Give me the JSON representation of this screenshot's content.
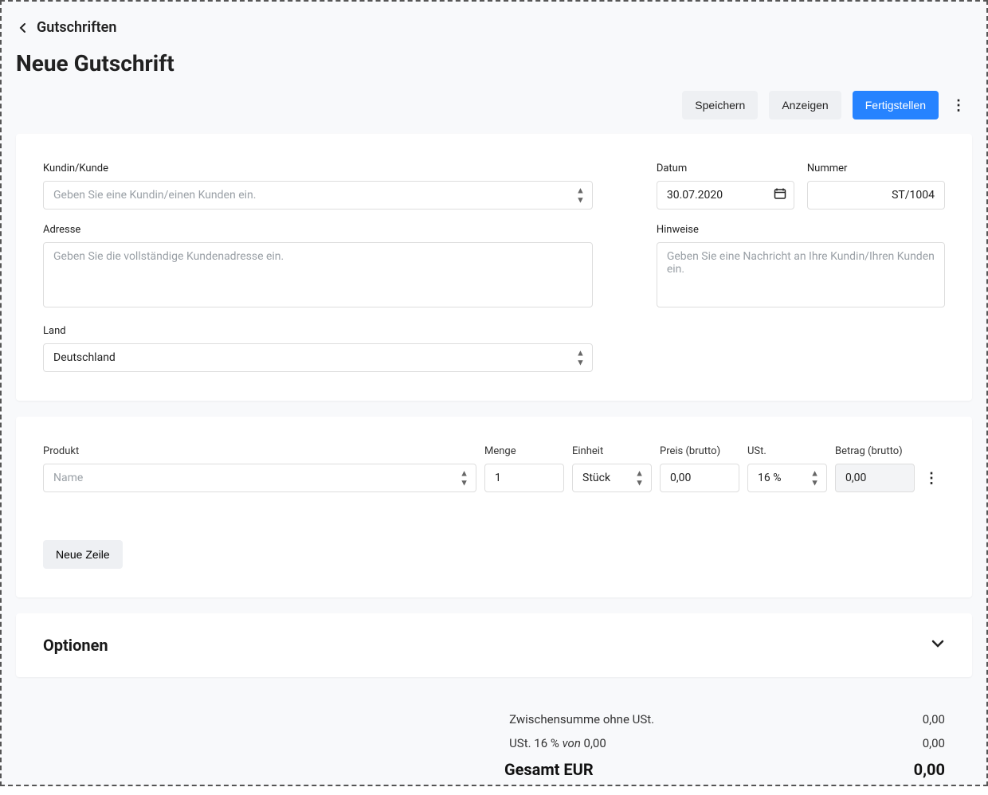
{
  "breadcrumb": {
    "title": "Gutschriften"
  },
  "page": {
    "title": "Neue Gutschrift"
  },
  "actions": {
    "save": "Speichern",
    "view": "Anzeigen",
    "finalize": "Fertigstellen"
  },
  "customer": {
    "label": "Kundin/Kunde",
    "placeholder": "Geben Sie eine Kundin/einen Kunden ein."
  },
  "address": {
    "label": "Adresse",
    "placeholder": "Geben Sie die vollständige Kundenadresse ein."
  },
  "country": {
    "label": "Land",
    "value": "Deutschland"
  },
  "date": {
    "label": "Datum",
    "value": "30.07.2020"
  },
  "number": {
    "label": "Nummer",
    "value": "ST/1004"
  },
  "notes": {
    "label": "Hinweise",
    "placeholder": "Geben Sie eine Nachricht an Ihre Kundin/Ihren Kunden ein."
  },
  "lineHeaders": {
    "product": "Produkt",
    "qty": "Menge",
    "unit": "Einheit",
    "price": "Preis (brutto)",
    "vat": "USt.",
    "amount": "Betrag (brutto)"
  },
  "lineItem": {
    "product_placeholder": "Name",
    "qty": "1",
    "unit": "Stück",
    "price": "0,00",
    "vat": "16 %",
    "amount": "0,00"
  },
  "newRow": "Neue Zeile",
  "options": {
    "title": "Optionen"
  },
  "totals": {
    "subtotal_label": "Zwischensumme ohne USt.",
    "subtotal_value": "0,00",
    "vat_label_prefix": "USt. 16 % ",
    "vat_of": "von ",
    "vat_base": "0,00",
    "vat_value": "0,00",
    "grand_label": "Gesamt EUR",
    "grand_value": "0,00"
  }
}
